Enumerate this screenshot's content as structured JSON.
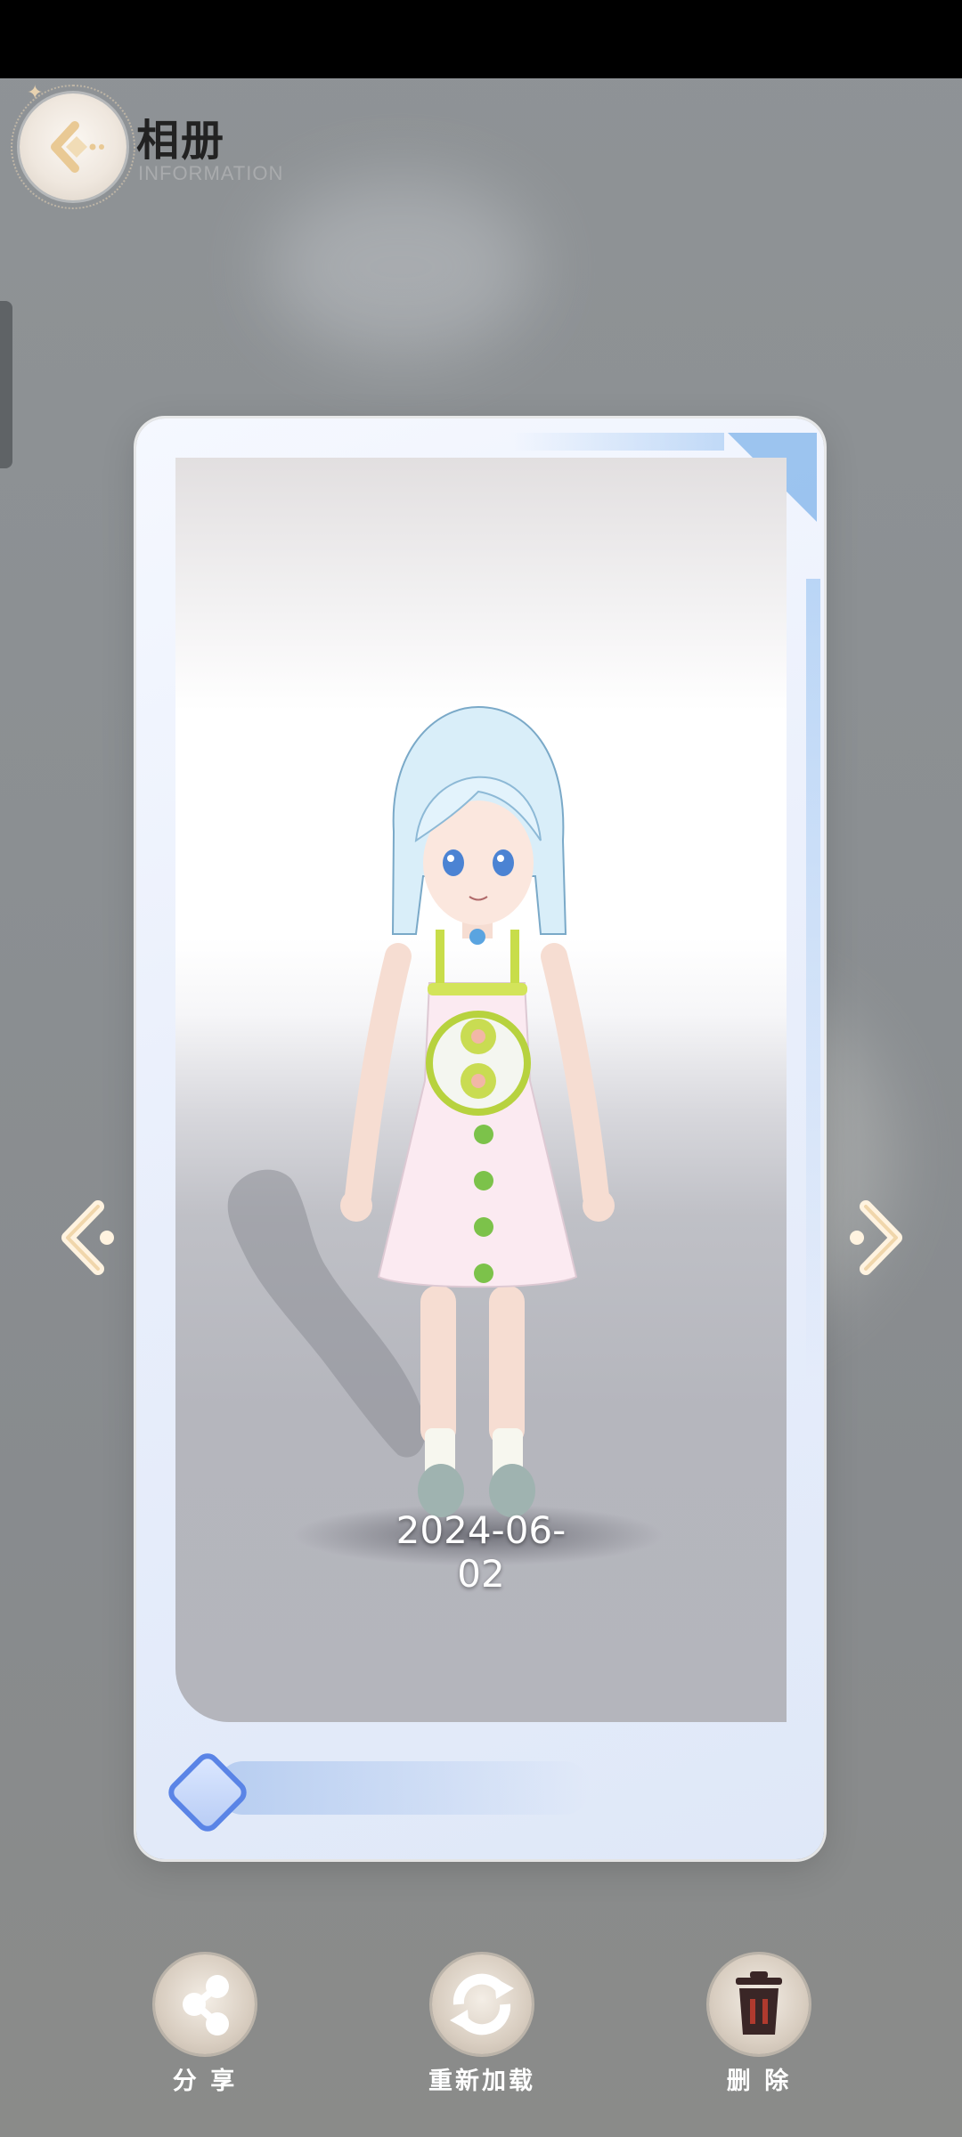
{
  "header": {
    "title": "相册",
    "subtitle": "INFORMATION",
    "back_icon": "back-arrow-icon"
  },
  "photo": {
    "date": "2024-06-02"
  },
  "actions": [
    {
      "label": "分 享",
      "icon": "share-icon"
    },
    {
      "label": "重新加载",
      "icon": "reload-icon"
    },
    {
      "label": "删 除",
      "icon": "trash-icon"
    }
  ],
  "colors": {
    "accent_blue": "#5a84e6",
    "gold": "#e9c994",
    "trash_red": "#b03a2e"
  }
}
